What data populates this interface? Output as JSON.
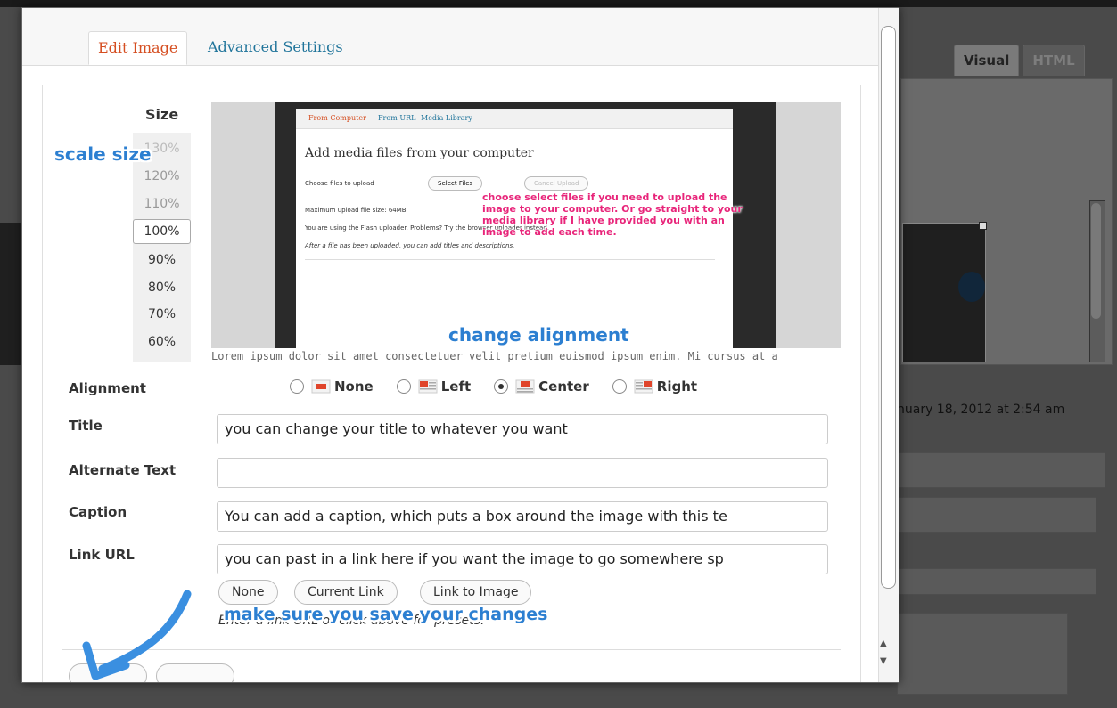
{
  "background": {
    "tabs": [
      "Visual",
      "HTML"
    ],
    "date_fragment": "nuary 18, 2012 at 2:54 am"
  },
  "modal": {
    "tabs": [
      {
        "label": "Edit Image",
        "active": true
      },
      {
        "label": "Advanced Settings",
        "active": false
      }
    ]
  },
  "size": {
    "heading": "Size",
    "options": [
      "130%",
      "120%",
      "110%",
      "100%",
      "90%",
      "80%",
      "70%",
      "60%"
    ],
    "selected": "100%"
  },
  "preview": {
    "inner_tabs": [
      "From Computer",
      "From URL",
      "Media Library"
    ],
    "inner_heading": "Add media files from your computer",
    "choose_label": "Choose files to upload",
    "select_files": "Select Files",
    "cancel_upload": "Cancel Upload",
    "max_size": "Maximum upload file size: 64MB",
    "flash_text": "You are using the Flash uploader. Problems? Try the browser uploader instead.",
    "after_text": "After a file has been uploaded, you can add titles and descriptions.",
    "caption_text": "Lorem ipsum dolor sit amet consectetuer velit pretium euismod ipsum enim. Mi cursus at a"
  },
  "annotations": {
    "scale_size": "scale size",
    "change_alignment": "change alignment",
    "pink_note": "choose select files if you need to upload the image to your computer. Or go straight to your media library if I have provided you with an image to add each time.",
    "save_note": "make sure you save your changes"
  },
  "form": {
    "alignment_label": "Alignment",
    "alignment_options": [
      "None",
      "Left",
      "Center",
      "Right"
    ],
    "alignment_selected": "Center",
    "title_label": "Title",
    "title_value": "you can change your title to whatever you want",
    "alt_label": "Alternate Text",
    "alt_value": "",
    "caption_label": "Caption",
    "caption_value": "You can add a caption, which puts a box around the image with this te",
    "link_label": "Link URL",
    "link_value": "you can past in a link here if you want the image to go somewhere sp",
    "link_buttons": [
      "None",
      "Current Link",
      "Link to Image"
    ],
    "link_hint": "Enter a link URL or click above for presets."
  },
  "colors": {
    "active_tab": "#d54e21",
    "link_blue": "#21759b",
    "annotation_blue": "#2c7fd1",
    "annotation_pink": "#e8257a",
    "arrow_blue": "#3a8fe0"
  }
}
